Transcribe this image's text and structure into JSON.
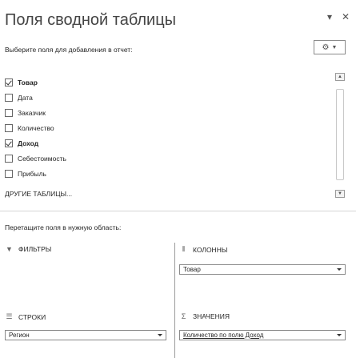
{
  "header": {
    "title": "Поля сводной таблицы",
    "dropdown_icon": "chevron-down-icon",
    "close_icon": "close-icon"
  },
  "choose_label": "Выберите поля для добавления в отчет:",
  "tools_button": {
    "icon": "gear-icon"
  },
  "fields": [
    {
      "label": "Товар",
      "checked": true
    },
    {
      "label": "Дата",
      "checked": false
    },
    {
      "label": "Заказчик",
      "checked": false
    },
    {
      "label": "Количество",
      "checked": false
    },
    {
      "label": "Доход",
      "checked": true
    },
    {
      "label": "Себестоимость",
      "checked": false
    },
    {
      "label": "Прибыль",
      "checked": false
    }
  ],
  "other_tables": "ДРУГИЕ ТАБЛИЦЫ...",
  "drag_hint": "Перетащите поля в нужную область:",
  "areas": {
    "filters": {
      "label": "ФИЛЬТРЫ",
      "icon": "filter-icon"
    },
    "columns": {
      "label": "КОЛОННЫ",
      "icon": "columns-icon",
      "items": [
        "Товар"
      ]
    },
    "rows": {
      "label": "СТРОКИ",
      "icon": "rows-icon",
      "items": [
        "Регион"
      ]
    },
    "values": {
      "label": "ЗНАЧЕНИЯ",
      "icon": "sigma-icon",
      "items": [
        "Количество по полю Доход"
      ]
    }
  }
}
